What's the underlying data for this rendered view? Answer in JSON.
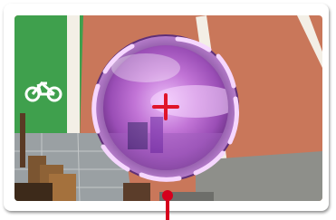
{
  "scene": {
    "description_icons": [
      "bicycle-lane-icon",
      "crosshair-icon",
      "zoom-lens",
      "position-pin-icon"
    ]
  },
  "colors": {
    "road_terracotta": "#c9775a",
    "bike_lane_green": "#3fa04d",
    "lane_line_white": "#f3efe6",
    "sidewalk_gray": "#9aa0a3",
    "lens_purple": "#b45ac8",
    "lens_rim": "#7d4a96",
    "crosshair_red": "#e0142a",
    "pin_red": "#d6001c"
  }
}
